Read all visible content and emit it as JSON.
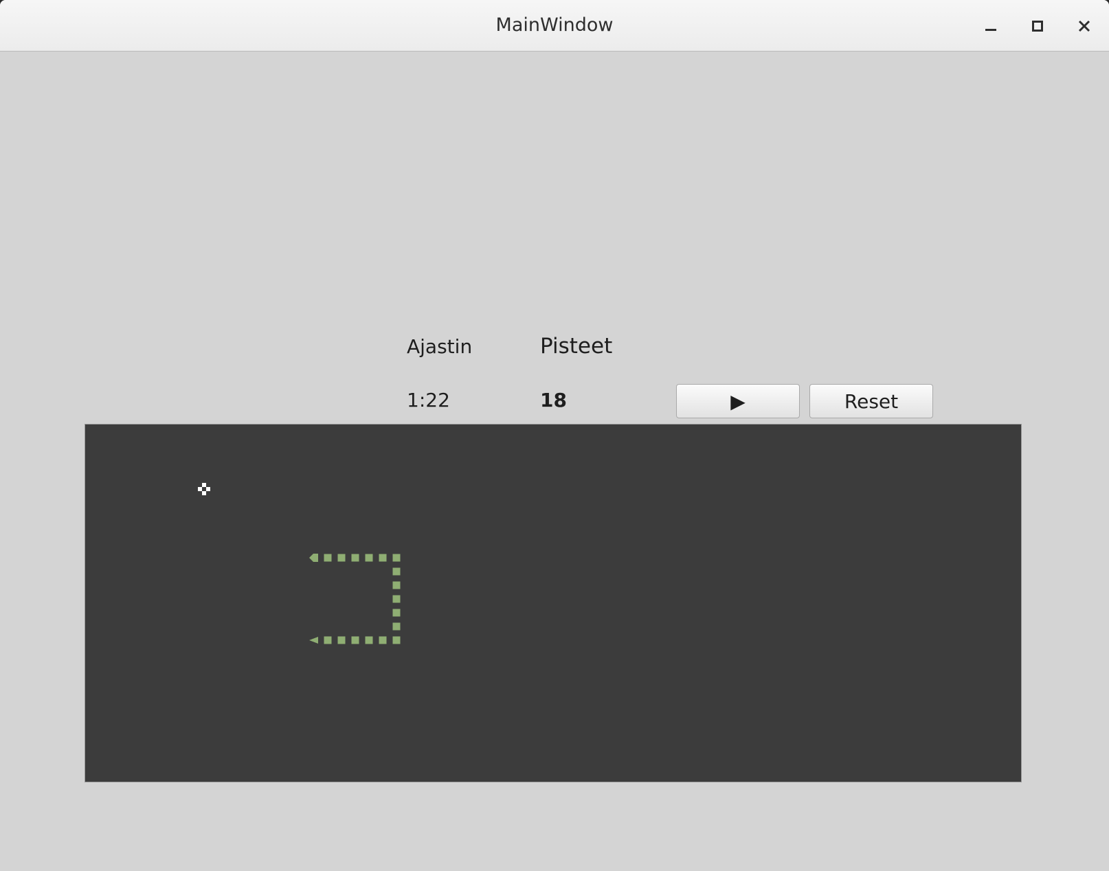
{
  "window": {
    "title": "MainWindow",
    "controls": [
      "minimize-icon",
      "maximize-icon",
      "close-icon"
    ]
  },
  "hud": {
    "timer_label": "Ajastin",
    "score_label": "Pisteet",
    "timer_value": "1:22",
    "score_value": "18"
  },
  "buttons": {
    "play_icon": "play-icon",
    "play_glyph": "▶",
    "reset_label": "Reset"
  },
  "game": {
    "colors": {
      "board": "#3c3c3c",
      "snake": "#8fae73",
      "food": "#ffffff"
    },
    "grid": {
      "cols": 68,
      "rows": 26
    },
    "food": {
      "col": 8,
      "row": 4
    },
    "snake": {
      "head": {
        "col": 16,
        "row": 9,
        "direction": "left"
      },
      "body": [
        [
          17,
          9
        ],
        [
          18,
          9
        ],
        [
          19,
          9
        ],
        [
          20,
          9
        ],
        [
          21,
          9
        ],
        [
          22,
          9
        ],
        [
          22,
          10
        ],
        [
          22,
          11
        ],
        [
          22,
          12
        ],
        [
          22,
          13
        ],
        [
          22,
          14
        ],
        [
          22,
          15
        ],
        [
          21,
          15
        ],
        [
          20,
          15
        ],
        [
          19,
          15
        ],
        [
          18,
          15
        ],
        [
          17,
          15
        ]
      ],
      "tail": {
        "col": 16,
        "row": 15,
        "direction": "left"
      }
    }
  }
}
